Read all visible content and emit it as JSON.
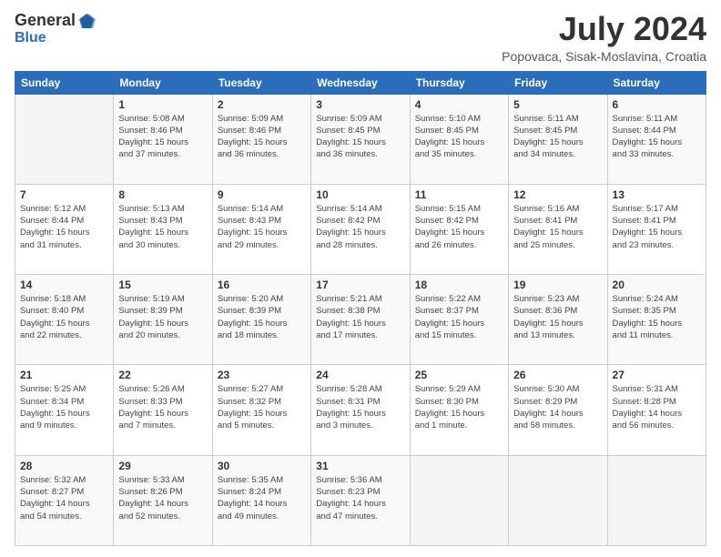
{
  "header": {
    "logo_general": "General",
    "logo_blue": "Blue",
    "title": "July 2024",
    "subtitle": "Popovaca, Sisak-Moslavina, Croatia"
  },
  "days_of_week": [
    "Sunday",
    "Monday",
    "Tuesday",
    "Wednesday",
    "Thursday",
    "Friday",
    "Saturday"
  ],
  "weeks": [
    [
      {
        "day": "",
        "info": ""
      },
      {
        "day": "1",
        "info": "Sunrise: 5:08 AM\nSunset: 8:46 PM\nDaylight: 15 hours\nand 37 minutes."
      },
      {
        "day": "2",
        "info": "Sunrise: 5:09 AM\nSunset: 8:46 PM\nDaylight: 15 hours\nand 36 minutes."
      },
      {
        "day": "3",
        "info": "Sunrise: 5:09 AM\nSunset: 8:45 PM\nDaylight: 15 hours\nand 36 minutes."
      },
      {
        "day": "4",
        "info": "Sunrise: 5:10 AM\nSunset: 8:45 PM\nDaylight: 15 hours\nand 35 minutes."
      },
      {
        "day": "5",
        "info": "Sunrise: 5:11 AM\nSunset: 8:45 PM\nDaylight: 15 hours\nand 34 minutes."
      },
      {
        "day": "6",
        "info": "Sunrise: 5:11 AM\nSunset: 8:44 PM\nDaylight: 15 hours\nand 33 minutes."
      }
    ],
    [
      {
        "day": "7",
        "info": "Sunrise: 5:12 AM\nSunset: 8:44 PM\nDaylight: 15 hours\nand 31 minutes."
      },
      {
        "day": "8",
        "info": "Sunrise: 5:13 AM\nSunset: 8:43 PM\nDaylight: 15 hours\nand 30 minutes."
      },
      {
        "day": "9",
        "info": "Sunrise: 5:14 AM\nSunset: 8:43 PM\nDaylight: 15 hours\nand 29 minutes."
      },
      {
        "day": "10",
        "info": "Sunrise: 5:14 AM\nSunset: 8:42 PM\nDaylight: 15 hours\nand 28 minutes."
      },
      {
        "day": "11",
        "info": "Sunrise: 5:15 AM\nSunset: 8:42 PM\nDaylight: 15 hours\nand 26 minutes."
      },
      {
        "day": "12",
        "info": "Sunrise: 5:16 AM\nSunset: 8:41 PM\nDaylight: 15 hours\nand 25 minutes."
      },
      {
        "day": "13",
        "info": "Sunrise: 5:17 AM\nSunset: 8:41 PM\nDaylight: 15 hours\nand 23 minutes."
      }
    ],
    [
      {
        "day": "14",
        "info": "Sunrise: 5:18 AM\nSunset: 8:40 PM\nDaylight: 15 hours\nand 22 minutes."
      },
      {
        "day": "15",
        "info": "Sunrise: 5:19 AM\nSunset: 8:39 PM\nDaylight: 15 hours\nand 20 minutes."
      },
      {
        "day": "16",
        "info": "Sunrise: 5:20 AM\nSunset: 8:39 PM\nDaylight: 15 hours\nand 18 minutes."
      },
      {
        "day": "17",
        "info": "Sunrise: 5:21 AM\nSunset: 8:38 PM\nDaylight: 15 hours\nand 17 minutes."
      },
      {
        "day": "18",
        "info": "Sunrise: 5:22 AM\nSunset: 8:37 PM\nDaylight: 15 hours\nand 15 minutes."
      },
      {
        "day": "19",
        "info": "Sunrise: 5:23 AM\nSunset: 8:36 PM\nDaylight: 15 hours\nand 13 minutes."
      },
      {
        "day": "20",
        "info": "Sunrise: 5:24 AM\nSunset: 8:35 PM\nDaylight: 15 hours\nand 11 minutes."
      }
    ],
    [
      {
        "day": "21",
        "info": "Sunrise: 5:25 AM\nSunset: 8:34 PM\nDaylight: 15 hours\nand 9 minutes."
      },
      {
        "day": "22",
        "info": "Sunrise: 5:26 AM\nSunset: 8:33 PM\nDaylight: 15 hours\nand 7 minutes."
      },
      {
        "day": "23",
        "info": "Sunrise: 5:27 AM\nSunset: 8:32 PM\nDaylight: 15 hours\nand 5 minutes."
      },
      {
        "day": "24",
        "info": "Sunrise: 5:28 AM\nSunset: 8:31 PM\nDaylight: 15 hours\nand 3 minutes."
      },
      {
        "day": "25",
        "info": "Sunrise: 5:29 AM\nSunset: 8:30 PM\nDaylight: 15 hours\nand 1 minute."
      },
      {
        "day": "26",
        "info": "Sunrise: 5:30 AM\nSunset: 8:29 PM\nDaylight: 14 hours\nand 58 minutes."
      },
      {
        "day": "27",
        "info": "Sunrise: 5:31 AM\nSunset: 8:28 PM\nDaylight: 14 hours\nand 56 minutes."
      }
    ],
    [
      {
        "day": "28",
        "info": "Sunrise: 5:32 AM\nSunset: 8:27 PM\nDaylight: 14 hours\nand 54 minutes."
      },
      {
        "day": "29",
        "info": "Sunrise: 5:33 AM\nSunset: 8:26 PM\nDaylight: 14 hours\nand 52 minutes."
      },
      {
        "day": "30",
        "info": "Sunrise: 5:35 AM\nSunset: 8:24 PM\nDaylight: 14 hours\nand 49 minutes."
      },
      {
        "day": "31",
        "info": "Sunrise: 5:36 AM\nSunset: 8:23 PM\nDaylight: 14 hours\nand 47 minutes."
      },
      {
        "day": "",
        "info": ""
      },
      {
        "day": "",
        "info": ""
      },
      {
        "day": "",
        "info": ""
      }
    ]
  ]
}
